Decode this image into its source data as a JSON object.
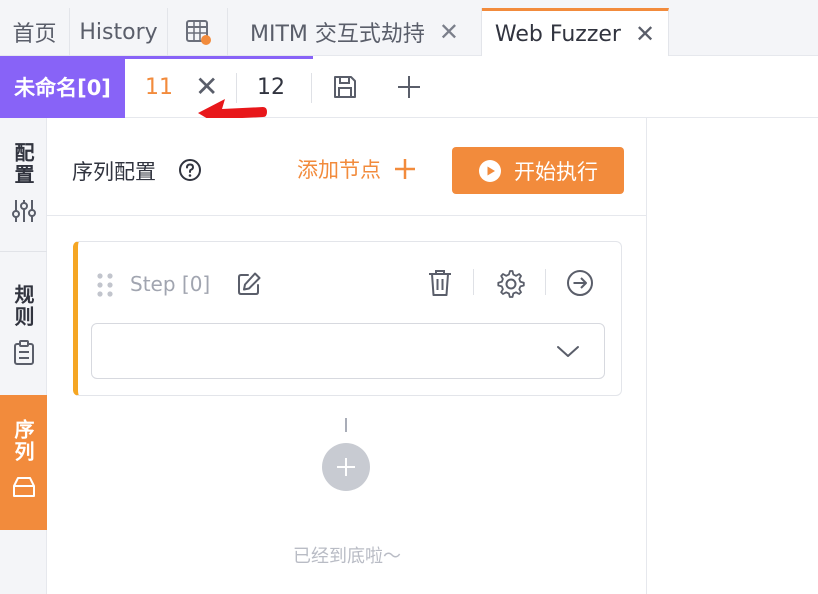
{
  "main_tabs": [
    {
      "label": "首页",
      "active": false,
      "closable": false
    },
    {
      "label": "History",
      "active": false,
      "closable": false
    },
    {
      "label": "",
      "icon": "table-calendar-icon",
      "active": false,
      "closable": false
    },
    {
      "label": "MITM 交互式劫持",
      "active": false,
      "closable": true
    },
    {
      "label": "Web Fuzzer",
      "active": true,
      "closable": true
    }
  ],
  "sub_tabs": {
    "group_label": "未命名[0]",
    "tabs": [
      {
        "label": "11",
        "active": true,
        "closable": true
      },
      {
        "label": "12",
        "active": false,
        "closable": false
      }
    ]
  },
  "sidebar": {
    "items": [
      {
        "label": "配置",
        "icon": "sliders-icon",
        "active": false
      },
      {
        "label": "规则",
        "icon": "clipboard-icon",
        "active": false
      },
      {
        "label": "序列",
        "icon": "layers-icon",
        "active": true
      }
    ]
  },
  "panel": {
    "title": "序列配置",
    "add_node_label": "添加节点",
    "start_button_label": "开始执行",
    "step": {
      "title": "Step [0]",
      "select_value": ""
    },
    "bottom_hint": "已经到底啦～"
  },
  "colors": {
    "accent": "#f28b3c",
    "group": "#8863f7",
    "step_border": "#f5a623",
    "annotation": "#e8171a"
  }
}
